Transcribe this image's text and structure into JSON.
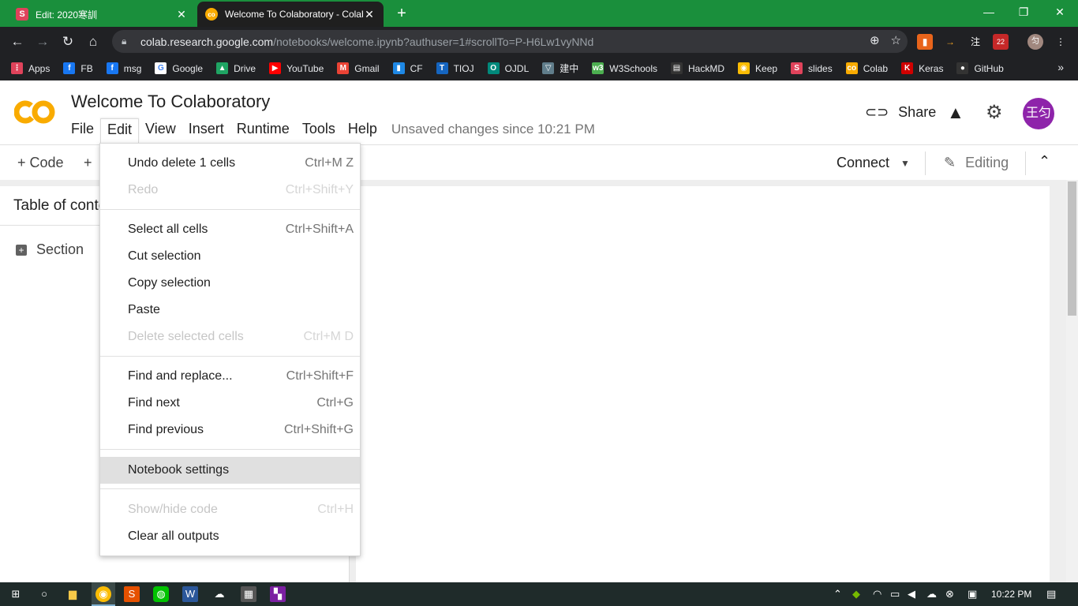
{
  "browser": {
    "tabs": [
      {
        "title": "Edit: 2020寒訓",
        "favicon_letter": "S",
        "favicon_color": "#e0435b"
      },
      {
        "title": "Welcome To Colaboratory - Colab",
        "favicon_letter": "co",
        "favicon_color": "#f9ab00"
      }
    ],
    "close_glyph": "✕",
    "new_tab_glyph": "+",
    "window_controls": [
      "—",
      "❐",
      "✕"
    ],
    "url_host": "colab.research.google.com",
    "url_path": "/notebooks/welcome.ipynb?authuser=1#scrollTo=P-H6Lw1vyNNd",
    "profile_initial": "匀",
    "extension_badge": "22",
    "extension_labels": [
      "注"
    ]
  },
  "bookmarks": [
    {
      "label": "Apps",
      "icon": "apps-grid-icon",
      "color": "#e0435b",
      "glyph": "⋮"
    },
    {
      "label": "FB",
      "icon": "facebook-icon",
      "color": "#1877f2",
      "glyph": "f"
    },
    {
      "label": "msg",
      "icon": "facebook-icon",
      "color": "#1877f2",
      "glyph": "f"
    },
    {
      "label": "Google",
      "icon": "google-icon",
      "color": "#ffffff",
      "glyph": "G"
    },
    {
      "label": "Drive",
      "icon": "drive-icon",
      "color": "#1fa463",
      "glyph": "▲"
    },
    {
      "label": "YouTube",
      "icon": "youtube-icon",
      "color": "#ff0000",
      "glyph": "▶"
    },
    {
      "label": "Gmail",
      "icon": "gmail-icon",
      "color": "#ea4335",
      "glyph": "M"
    },
    {
      "label": "CF",
      "icon": "codeforces-icon",
      "color": "#1e88e5",
      "glyph": "▮"
    },
    {
      "label": "TIOJ",
      "icon": "tioj-icon",
      "color": "#1565c0",
      "glyph": "T"
    },
    {
      "label": "OJDL",
      "icon": "ojdl-icon",
      "color": "#00897b",
      "glyph": "O"
    },
    {
      "label": "建中",
      "icon": "school-icon",
      "color": "#607d8b",
      "glyph": "▽"
    },
    {
      "label": "W3Schools",
      "icon": "w3schools-icon",
      "color": "#4caf50",
      "glyph": "w3"
    },
    {
      "label": "HackMD",
      "icon": "hackmd-icon",
      "color": "#333333",
      "glyph": "▤"
    },
    {
      "label": "Keep",
      "icon": "keep-icon",
      "color": "#fbbc04",
      "glyph": "◉"
    },
    {
      "label": "slides",
      "icon": "slides-icon",
      "color": "#e0435b",
      "glyph": "S"
    },
    {
      "label": "Colab",
      "icon": "colab-icon",
      "color": "#f9ab00",
      "glyph": "co"
    },
    {
      "label": "Keras",
      "icon": "keras-icon",
      "color": "#d00000",
      "glyph": "K"
    },
    {
      "label": "GitHub",
      "icon": "github-icon",
      "color": "#333333",
      "glyph": "●"
    }
  ],
  "colab": {
    "title": "Welcome To Colaboratory",
    "menu": [
      "File",
      "Edit",
      "View",
      "Insert",
      "Runtime",
      "Tools",
      "Help"
    ],
    "unsaved": "Unsaved changes since 10:21 PM",
    "share": "Share",
    "avatar_text": "王匀",
    "add_code": "+ Code",
    "add_text": "+",
    "connect": "Connect",
    "editing": "Editing",
    "toc_title": "Table of contents",
    "section": "Section"
  },
  "edit_menu": {
    "groups": [
      [
        {
          "label": "Undo delete 1 cells",
          "shortcut": "Ctrl+M Z",
          "disabled": false
        },
        {
          "label": "Redo",
          "shortcut": "Ctrl+Shift+Y",
          "disabled": true
        }
      ],
      [
        {
          "label": "Select all cells",
          "shortcut": "Ctrl+Shift+A",
          "disabled": false
        },
        {
          "label": "Cut selection",
          "shortcut": "",
          "disabled": false
        },
        {
          "label": "Copy selection",
          "shortcut": "",
          "disabled": false
        },
        {
          "label": "Paste",
          "shortcut": "",
          "disabled": false
        },
        {
          "label": "Delete selected cells",
          "shortcut": "Ctrl+M D",
          "disabled": true
        }
      ],
      [
        {
          "label": "Find and replace...",
          "shortcut": "Ctrl+Shift+F",
          "disabled": false
        },
        {
          "label": "Find next",
          "shortcut": "Ctrl+G",
          "disabled": false
        },
        {
          "label": "Find previous",
          "shortcut": "Ctrl+Shift+G",
          "disabled": false
        }
      ],
      [
        {
          "label": "Notebook settings",
          "shortcut": "",
          "disabled": false,
          "hover": true
        }
      ],
      [
        {
          "label": "Show/hide code",
          "shortcut": "Ctrl+H",
          "disabled": true
        },
        {
          "label": "Clear all outputs",
          "shortcut": "",
          "disabled": false
        }
      ]
    ]
  },
  "taskbar": {
    "clock": "10:22 PM"
  },
  "colors": {
    "tabstrip": "#1a8f3c",
    "chrome_dark": "#202124",
    "colab_orange": "#f9ab00",
    "avatar": "#8e24aa"
  }
}
